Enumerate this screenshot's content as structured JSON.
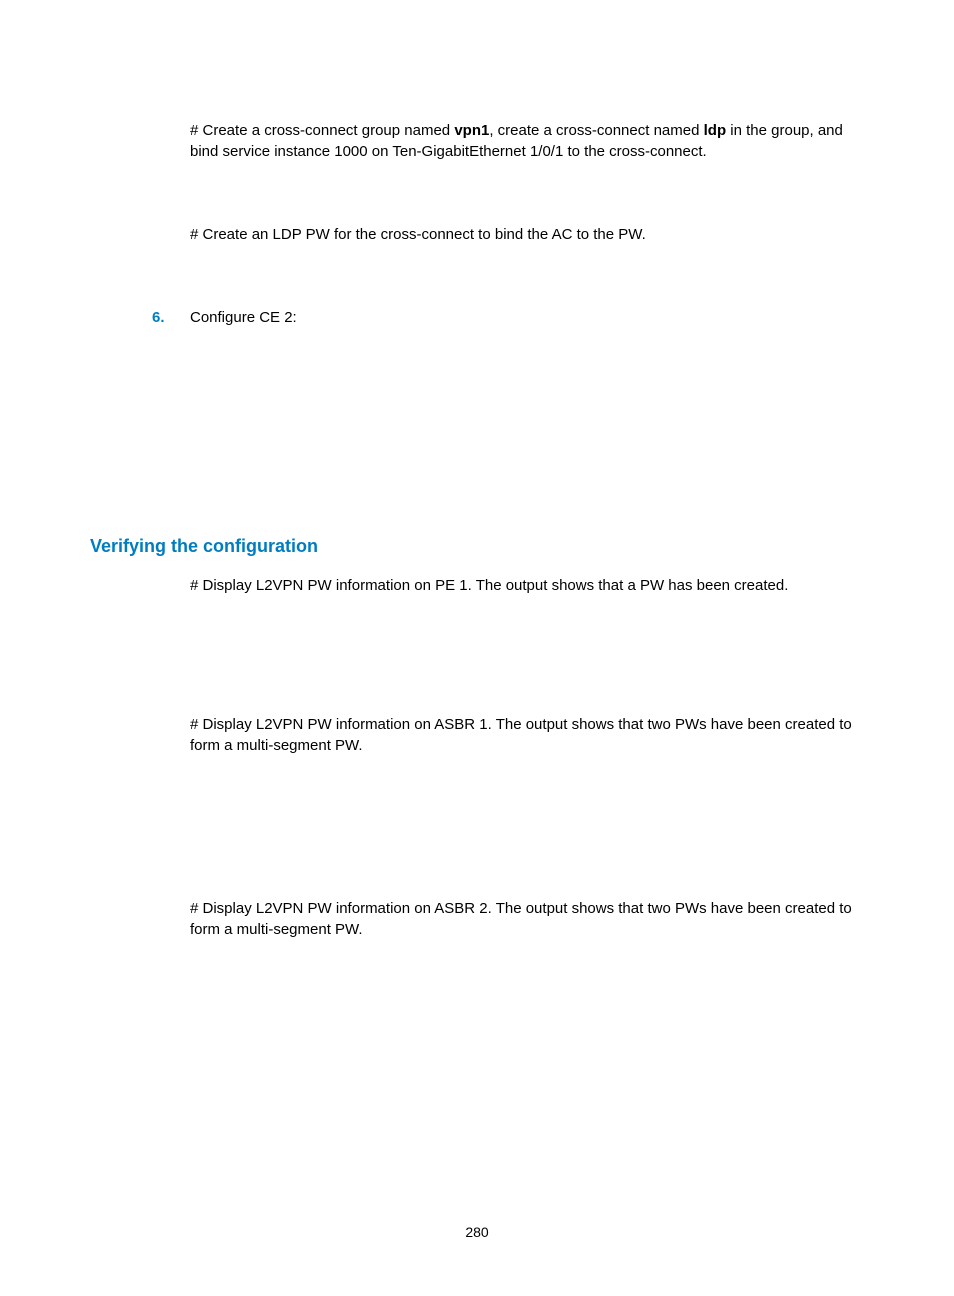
{
  "para1_pre": "# Create a cross-connect group named ",
  "para1_b1": "vpn1",
  "para1_mid": ", create a cross-connect named ",
  "para1_b2": "ldp",
  "para1_post": " in the group, and bind service instance 1000 on Ten-GigabitEthernet 1/0/1 to the cross-connect.",
  "para2": "# Create an LDP PW for the cross-connect to bind the AC to the PW.",
  "list_num": "6.",
  "list_text": "Configure CE 2:",
  "heading": "Verifying the configuration",
  "para3": "# Display L2VPN PW information on PE 1. The output shows that a PW has been created.",
  "para4": "# Display L2VPN PW information on ASBR 1. The output shows that two PWs have been created to form a multi-segment PW.",
  "para5": "# Display L2VPN PW information on ASBR 2. The output shows that two PWs have been created to form a multi-segment PW.",
  "page_number": "280"
}
